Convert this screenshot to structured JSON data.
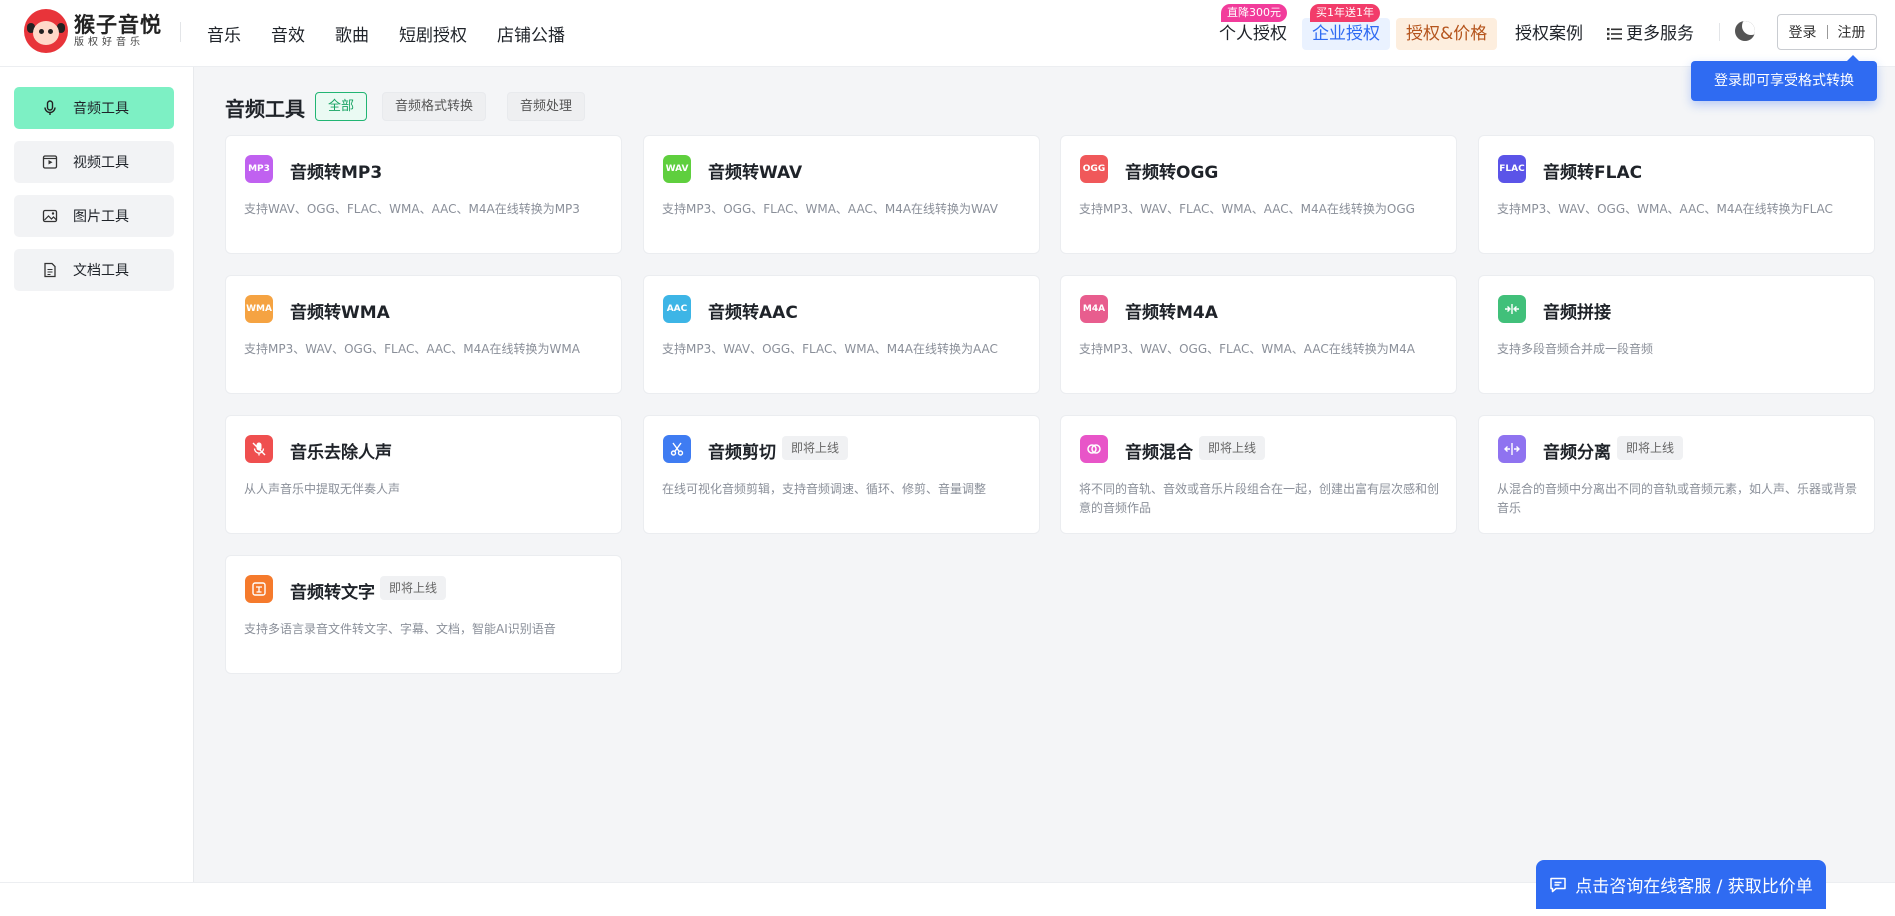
{
  "brand": {
    "title": "猴子音悦",
    "subtitle": "版权好音乐"
  },
  "nav_left": [
    "音乐",
    "音效",
    "歌曲",
    "短剧授权",
    "店铺公播"
  ],
  "nav_right": {
    "personal": "个人授权",
    "personal_badge": "直降300元",
    "enterprise": "企业授权",
    "enterprise_badge": "买1年送1年",
    "pricing": "授权&价格",
    "cases": "授权案例",
    "more": "更多服务",
    "login": "登录",
    "register": "注册"
  },
  "tooltip": "登录即可享受格式转换",
  "sidebar": [
    {
      "label": "音频工具",
      "icon": "microphone-icon",
      "active": true
    },
    {
      "label": "视频工具",
      "icon": "video-icon",
      "active": false
    },
    {
      "label": "图片工具",
      "icon": "image-icon",
      "active": false
    },
    {
      "label": "文档工具",
      "icon": "document-icon",
      "active": false
    }
  ],
  "main": {
    "title": "音频工具",
    "filters": [
      "全部",
      "音频格式转换",
      "音频处理"
    ]
  },
  "tools": [
    {
      "title": "音频转MP3",
      "icon_text": "MP3",
      "icon_color": "#c061f0",
      "desc": "支持WAV、OGG、FLAC、WMA、AAC、M4A在线转换为MP3"
    },
    {
      "title": "音频转WAV",
      "icon_text": "WAV",
      "icon_color": "#5fcf3e",
      "desc": "支持MP3、OGG、FLAC、WMA、AAC、M4A在线转换为WAV"
    },
    {
      "title": "音频转OGG",
      "icon_text": "OGG",
      "icon_color": "#f0585a",
      "desc": "支持MP3、WAV、FLAC、WMA、AAC、M4A在线转换为OGG"
    },
    {
      "title": "音频转FLAC",
      "icon_text": "FLAC",
      "icon_color": "#5b54e8",
      "desc": "支持MP3、WAV、OGG、WMA、AAC、M4A在线转换为FLAC"
    },
    {
      "title": "音频转WMA",
      "icon_text": "WMA",
      "icon_color": "#f5a342",
      "desc": "支持MP3、WAV、OGG、FLAC、AAC、M4A在线转换为WMA"
    },
    {
      "title": "音频转AAC",
      "icon_text": "AAC",
      "icon_color": "#3db5e6",
      "desc": "支持MP3、WAV、OGG、FLAC、WMA、M4A在线转换为AAC"
    },
    {
      "title": "音频转M4A",
      "icon_text": "M4A",
      "icon_color": "#e85d8e",
      "desc": "支持MP3、WAV、OGG、FLAC、WMA、AAC在线转换为M4A"
    },
    {
      "title": "音频拼接",
      "icon_text": "",
      "icon_name": "merge-icon",
      "icon_color": "#41c07a",
      "desc": "支持多段音频合并成一段音频"
    },
    {
      "title": "音乐去除人声",
      "icon_text": "",
      "icon_name": "mute-mic-icon",
      "icon_color": "#ef4f4f",
      "desc": "从人声音乐中提取无伴奏人声"
    },
    {
      "title": "音频剪切",
      "icon_text": "",
      "icon_name": "scissors-icon",
      "icon_color": "#3f7cf2",
      "badge": "即将上线",
      "desc": "在线可视化音频剪辑，支持音频调速、循环、修剪、音量调整"
    },
    {
      "title": "音频混合",
      "icon_text": "",
      "icon_name": "mix-icon",
      "icon_color": "#e855c8",
      "badge": "即将上线",
      "desc": "将不同的音轨、音效或音乐片段组合在一起，创建出富有层次感和创意的音频作品"
    },
    {
      "title": "音频分离",
      "icon_text": "",
      "icon_name": "split-icon",
      "icon_color": "#8f73f0",
      "badge": "即将上线",
      "desc": "从混合的音频中分离出不同的音轨或音频元素，如人声、乐器或背景音乐"
    },
    {
      "title": "音频转文字",
      "icon_text": "",
      "icon_name": "transcribe-icon",
      "icon_color": "#f57a2c",
      "badge": "即将上线",
      "desc": "支持多语言录音文件转文字、字幕、文档，智能AI识别语音"
    }
  ],
  "consult": "点击咨询在线客服 / 获取比价单",
  "colors": {
    "primary": "#2f6bf2",
    "accent_green": "#7df0c4",
    "brand_red": "#e8343a"
  }
}
